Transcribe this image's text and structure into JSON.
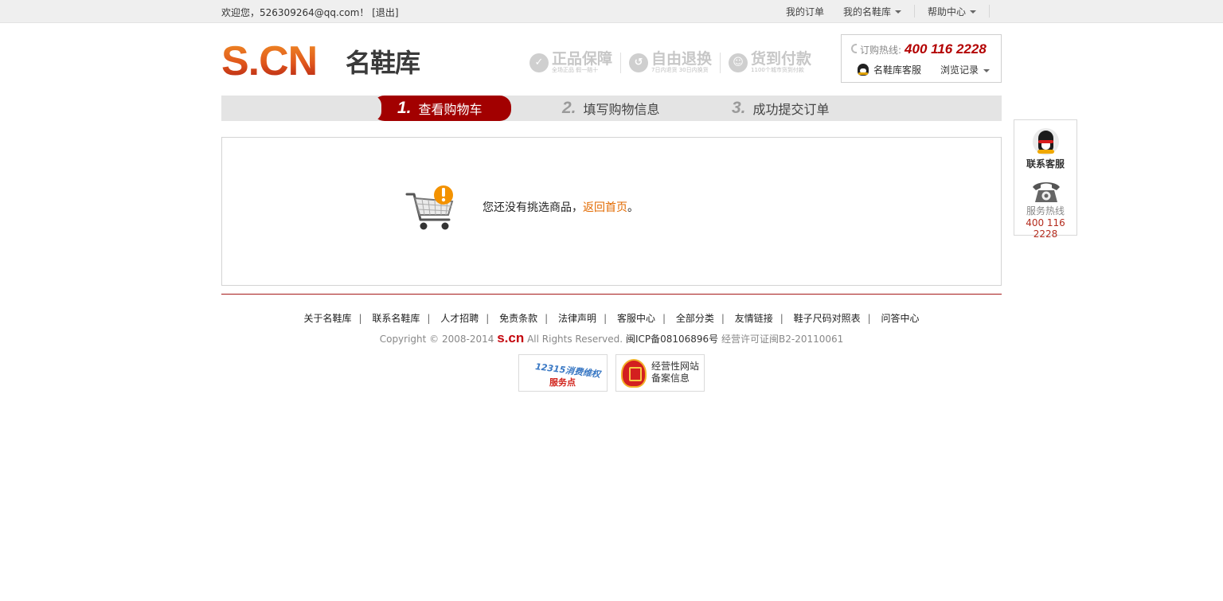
{
  "topbar": {
    "welcome_prefix": "欢迎您，",
    "user_email": "526309264@qq.com",
    "exclaim": "！",
    "logout": "[退出]",
    "links": [
      "我的订单",
      "我的名鞋库",
      "帮助中心"
    ]
  },
  "header": {
    "logo_latin": "S.CN",
    "logo_cn": "名鞋库",
    "promises": [
      {
        "title": "正品保障",
        "sub": "全场正品  假一赔十",
        "icon": "check-badge-icon"
      },
      {
        "title": "自由退换",
        "sub": "7日内退货 30日内换货",
        "icon": "return-badge-icon"
      },
      {
        "title": "货到付款",
        "sub": "1100个城市货到付款",
        "icon": "smile-badge-icon"
      }
    ],
    "hotline_label": "订购热线:",
    "hotline_number": "400 116 2228",
    "service_label": "名鞋库客服",
    "history_label": "浏览记录"
  },
  "steps": [
    {
      "num": "1.",
      "label": "查看购物车"
    },
    {
      "num": "2.",
      "label": "填写购物信息"
    },
    {
      "num": "3.",
      "label": "成功提交订单"
    }
  ],
  "main": {
    "empty_text": "您还没有挑选商品，",
    "home_link": "返回首页",
    "period": "。"
  },
  "side": {
    "contact_label": "联系客服",
    "hotline_label": "服务热线",
    "hotline_number": "400 116 2228"
  },
  "footer": {
    "links": [
      "关于名鞋库",
      "联系名鞋库",
      "人才招聘",
      "免责条款",
      "法律声明",
      "客服中心",
      "全部分类",
      "友情链接",
      "鞋子尺码对照表",
      "问答中心"
    ],
    "copyright_prefix": "Copyright © 2008-2014",
    "brand": "s.cn",
    "rights": "All Rights Reserved.",
    "icp": "闽ICP备08106896号",
    "license": "经营许可证闽B2-20110061",
    "badge1_top": "12315消费维权",
    "badge1_bottom": "服务点",
    "badge2_line1": "经营性网站",
    "badge2_line2": "备案信息"
  },
  "colors": {
    "accent_red": "#a20000",
    "link_orange": "#e26a00",
    "hotline_red": "#b30000"
  }
}
